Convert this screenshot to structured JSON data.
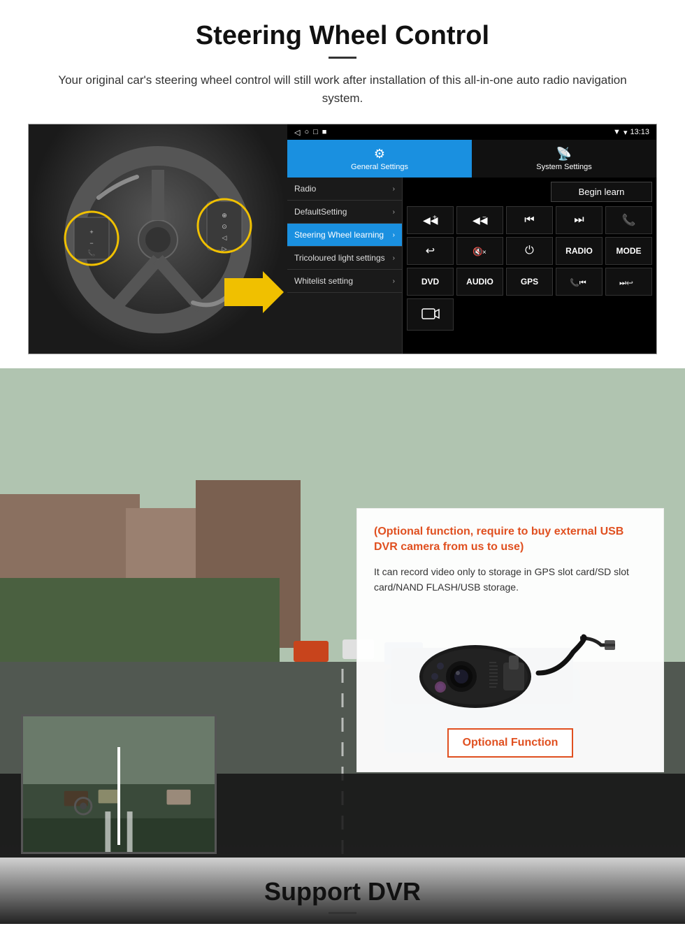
{
  "page": {
    "steering": {
      "title": "Steering Wheel Control",
      "description": "Your original car's steering wheel control will still work after installation of this all-in-one auto radio navigation system.",
      "statusbar": {
        "icons_left": [
          "◁",
          "○",
          "□",
          "■"
        ],
        "signal": "▾",
        "wifi": "▾",
        "time": "13:13"
      },
      "tabs": [
        {
          "id": "general",
          "label": "General Settings",
          "icon": "⚙"
        },
        {
          "id": "system",
          "label": "System Settings",
          "icon": "📡"
        }
      ],
      "menu_items": [
        {
          "label": "Radio",
          "active": false
        },
        {
          "label": "DefaultSetting",
          "active": false
        },
        {
          "label": "Steering Wheel learning",
          "active": true
        },
        {
          "label": "Tricoloured light settings",
          "active": false
        },
        {
          "label": "Whitelist setting",
          "active": false
        }
      ],
      "begin_learn": "Begin learn",
      "control_buttons": [
        {
          "label": "◀◀+",
          "row": 1
        },
        {
          "label": "◀◀−",
          "row": 1
        },
        {
          "label": "⏮",
          "row": 1
        },
        {
          "label": "⏭",
          "row": 1
        },
        {
          "label": "📞",
          "row": 1
        },
        {
          "label": "↩",
          "row": 2
        },
        {
          "label": "🔇×",
          "row": 2
        },
        {
          "label": "⏻",
          "row": 2
        },
        {
          "label": "RADIO",
          "row": 2,
          "text": true
        },
        {
          "label": "MODE",
          "row": 2,
          "text": true
        },
        {
          "label": "DVD",
          "row": 3,
          "text": true
        },
        {
          "label": "AUDIO",
          "row": 3,
          "text": true
        },
        {
          "label": "GPS",
          "row": 3,
          "text": true
        },
        {
          "label": "📞⏮",
          "row": 3
        },
        {
          "label": "⏭↩",
          "row": 3
        },
        {
          "label": "🎬",
          "row": 4
        }
      ]
    },
    "dvr": {
      "title": "Support DVR",
      "card": {
        "optional_text": "(Optional function, require to buy external USB DVR camera from us to use)",
        "description": "It can record video only to storage in GPS slot card/SD slot card/NAND FLASH/USB storage.",
        "optional_button": "Optional Function"
      }
    }
  }
}
